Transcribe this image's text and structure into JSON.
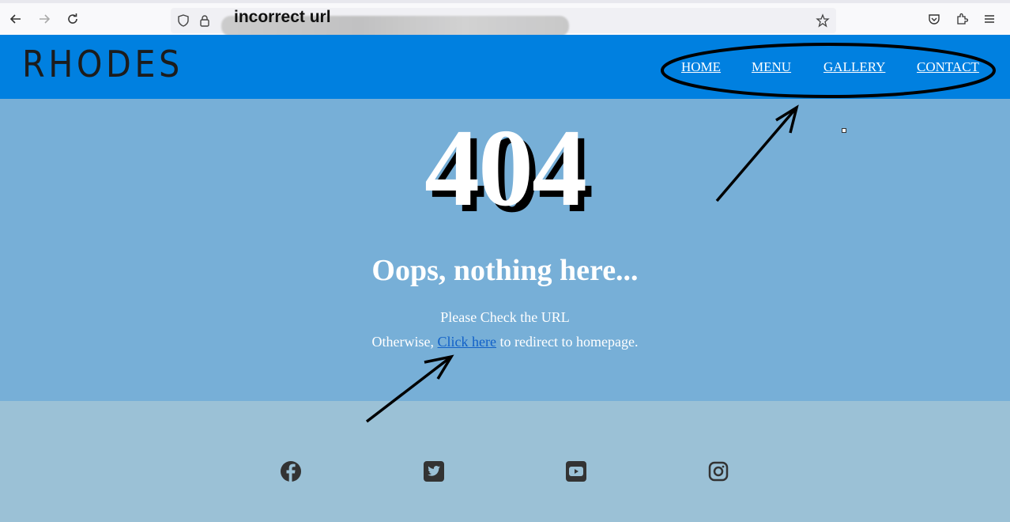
{
  "browser": {
    "url_annotation": "incorrect url"
  },
  "site": {
    "logo": "RHODES",
    "nav": [
      {
        "label": "HOME"
      },
      {
        "label": "MENU"
      },
      {
        "label": "GALLERY"
      },
      {
        "label": "CONTACT"
      }
    ]
  },
  "error": {
    "code": "404",
    "heading": "Oops, nothing here...",
    "line1": "Please Check the URL",
    "line2_prefix": "Otherwise, ",
    "link_label": "Click here",
    "line2_suffix": " to redirect to homepage."
  },
  "footer": {
    "social_icons": [
      "facebook-icon",
      "twitter-icon",
      "youtube-icon",
      "instagram-icon"
    ]
  },
  "colors": {
    "header_bg": "#0080e0",
    "hero_bg": "#77afd7",
    "footer_bg": "#9bc1d6",
    "link": "#1060c8"
  }
}
